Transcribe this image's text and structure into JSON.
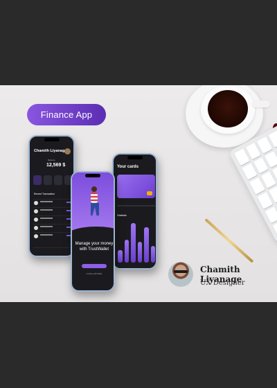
{
  "badge": {
    "label": "Finance App"
  },
  "author": {
    "name": "Chamith Liyanage",
    "role": "UX Designer"
  },
  "phone_home": {
    "user_name": "Chamith Liyanage",
    "balance_label": "Balance",
    "balance": "12,569 $",
    "section_title": "Recent Transaction"
  },
  "phone_onboarding": {
    "headline": "Manage your money with TrustWallet",
    "link": "Continue with Wallet"
  },
  "phone_cards": {
    "title": "Your cards",
    "chart_label": "Statistic"
  },
  "colors": {
    "accent": "#7b4fdc",
    "accent_light": "#a77bf0"
  }
}
